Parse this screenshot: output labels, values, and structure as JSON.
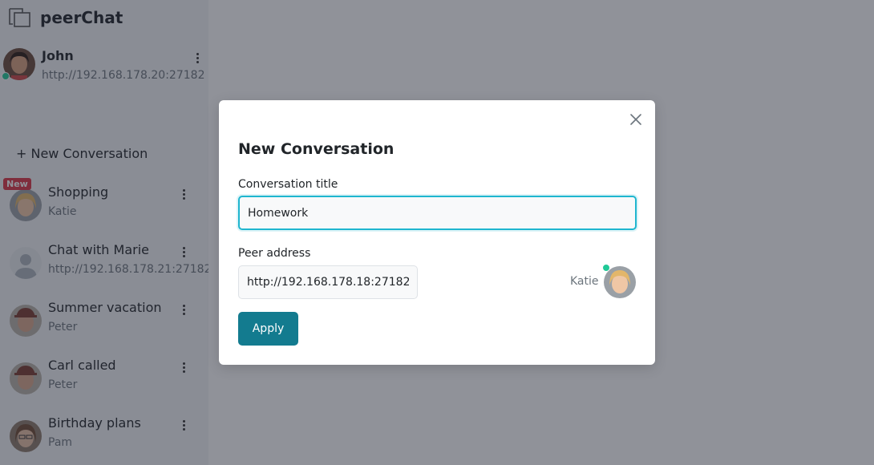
{
  "app": {
    "name": "peerChat"
  },
  "me": {
    "name": "John",
    "address": "http://192.168.178.20:27182",
    "online": true
  },
  "sidebar": {
    "new_conversation_label": "+ New Conversation",
    "conversations": [
      {
        "title": "Shopping",
        "subtitle": "Katie",
        "badge": "New",
        "avatar": "katie"
      },
      {
        "title": "Chat with Marie",
        "subtitle": "http://192.168.178.21:27182",
        "avatar": "placeholder"
      },
      {
        "title": "Summer vacation",
        "subtitle": "Peter",
        "avatar": "peter"
      },
      {
        "title": "Carl called",
        "subtitle": "Peter",
        "avatar": "peter"
      },
      {
        "title": "Birthday plans",
        "subtitle": "Pam",
        "avatar": "pam"
      }
    ]
  },
  "modal": {
    "title": "New Conversation",
    "conversation_title_label": "Conversation title",
    "conversation_title_value": "Homework",
    "peer_address_label": "Peer address",
    "peer_address_value": "http://192.168.178.18:27182",
    "peer_name": "Katie",
    "peer_online": true,
    "apply_label": "Apply"
  },
  "colors": {
    "accent": "#137b8f",
    "focus": "#1fb6cf",
    "online": "#20c997",
    "badge": "#dc3545",
    "backdrop": "rgba(33,37,51,0.5)"
  },
  "icons": [
    "peerchat-logo-icon",
    "kebab-menu-icon",
    "close-icon",
    "online-status-icon",
    "user-placeholder-icon"
  ]
}
